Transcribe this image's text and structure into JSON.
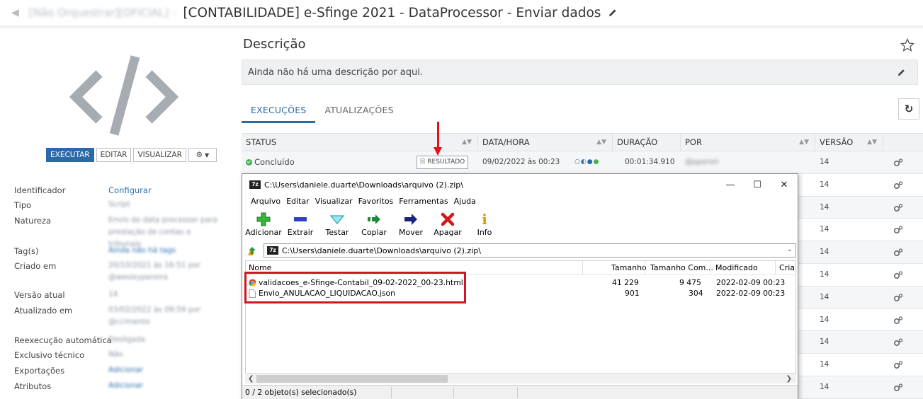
{
  "header": {
    "breadcrumb": "[Não Orquestrar][OFICIAL]",
    "separator": "-",
    "title": "[CONTABILIDADE] e-Sfinge 2021 - DataProcessor - Enviar dados"
  },
  "left": {
    "buttons": {
      "execute": "EXECUTAR",
      "edit": "EDITAR",
      "view": "VISUALIZAR"
    },
    "meta": [
      {
        "label": "Identificador",
        "value": "Configurar",
        "link": true
      },
      {
        "label": "Tipo",
        "value": "Script"
      },
      {
        "label": "Natureza",
        "value": "Envio do data processor para prestação de contas a tribunais"
      },
      {
        "label": "Tag(s)",
        "value": "Ainda não há tags"
      },
      {
        "label": "Criado em",
        "value": "20/10/2021 às 16:51 por @wesleypereira"
      },
      {
        "label": "Versão atual",
        "value": "14"
      },
      {
        "label": "Atualizado em",
        "value": "03/02/2022 às 09:59 por @ccimento"
      },
      {
        "label": "Reexecução automática",
        "value": "Desligada"
      },
      {
        "label": "Exclusivo técnico",
        "value": "Não"
      },
      {
        "label": "Exportações",
        "value": "Adicionar"
      },
      {
        "label": "Atributos",
        "value": "Adicionar"
      }
    ]
  },
  "main": {
    "description_title": "Descrição",
    "description_text": "Ainda não há uma descrição por aqui.",
    "tabs": [
      "EXECUÇÕES",
      "ATUALIZAÇÕES"
    ],
    "table": {
      "columns": [
        "STATUS",
        "DATA/HORA",
        "DURAÇÃO",
        "POR",
        "VERSÃO"
      ],
      "first_row": {
        "status": "Concluído",
        "result_button": "RESULTADO",
        "datetime": "09/02/2022 às 00:23",
        "duration": "00:01:34.910",
        "by": "@pperon",
        "version": "14"
      },
      "versions": [
        "14",
        "14",
        "14",
        "14",
        "14",
        "14",
        "14",
        "14",
        "14",
        "14",
        "14"
      ]
    }
  },
  "zip": {
    "title": "C:\\Users\\daniele.duarte\\Downloads\\arquivo (2).zip\\",
    "menu": [
      "Arquivo",
      "Editar",
      "Visualizar",
      "Favoritos",
      "Ferramentas",
      "Ajuda"
    ],
    "toolbar": [
      "Adicionar",
      "Extrair",
      "Testar",
      "Copiar",
      "Mover",
      "Apagar",
      "Info"
    ],
    "address": "C:\\Users\\daniele.duarte\\Downloads\\arquivo (2).zip\\",
    "columns": [
      "Nome",
      "Tamanho",
      "Tamanho Com...",
      "Modificado",
      "Cria"
    ],
    "files": [
      {
        "name": "validacoes_e-Sfinge-Contabil_09-02-2022_00-23.html",
        "size": "41 229",
        "packed": "9 475",
        "modified": "2022-02-09 00:23",
        "icon": "chrome-icon"
      },
      {
        "name": "Envio_ANULACAO_LIQUIDACAO.json",
        "size": "901",
        "packed": "304",
        "modified": "2022-02-09 00:23",
        "icon": "file-icon"
      }
    ],
    "status": "0 / 2 objeto(s) selecionado(s)"
  },
  "colors": {
    "accent": "#2b6aa6",
    "annotation": "#d0161e",
    "success": "#4caf50"
  }
}
